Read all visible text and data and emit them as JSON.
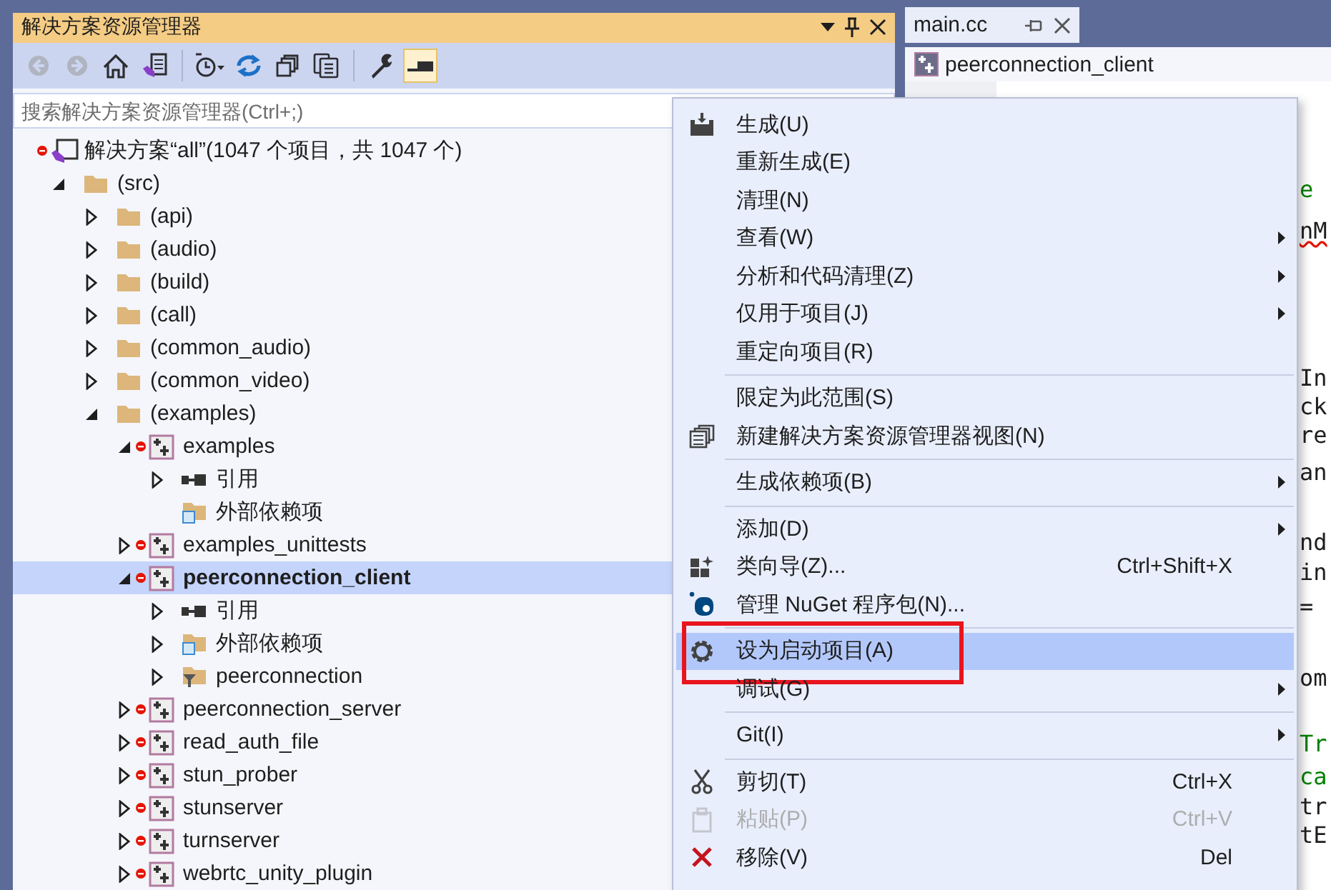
{
  "explorer": {
    "title": "解决方案资源管理器",
    "toolbar": [
      {
        "kind": "back",
        "disabled": true,
        "on": false
      },
      {
        "kind": "forward",
        "disabled": true,
        "on": false
      },
      {
        "kind": "home",
        "disabled": false,
        "on": false
      },
      {
        "kind": "solution-view",
        "disabled": false,
        "on": false
      },
      {
        "kind": "separator"
      },
      {
        "kind": "history",
        "disabled": false,
        "on": false
      },
      {
        "kind": "refresh",
        "disabled": false,
        "on": false
      },
      {
        "kind": "collapse",
        "disabled": false,
        "on": false
      },
      {
        "kind": "copy",
        "disabled": false,
        "on": false
      },
      {
        "kind": "separator"
      },
      {
        "kind": "properties",
        "disabled": false,
        "on": false
      },
      {
        "kind": "preview",
        "disabled": false,
        "on": true
      }
    ],
    "search": {
      "placeholder": "搜索解决方案资源管理器(Ctrl+;)"
    },
    "tree": [
      {
        "label": "解决方案“all”(1047 个项目，共 1047 个)",
        "kind": "solution",
        "error": true,
        "bold": false,
        "selected": false,
        "children": [
          {
            "label": "(src)",
            "kind": "folder",
            "expanded": true,
            "error": false,
            "bold": false,
            "selected": false,
            "children": [
              {
                "label": "(api)",
                "kind": "folder",
                "expanded": false,
                "error": false,
                "bold": false,
                "selected": false
              },
              {
                "label": "(audio)",
                "kind": "folder",
                "expanded": false,
                "error": false,
                "bold": false,
                "selected": false
              },
              {
                "label": "(build)",
                "kind": "folder",
                "expanded": false,
                "error": false,
                "bold": false,
                "selected": false
              },
              {
                "label": "(call)",
                "kind": "folder",
                "expanded": false,
                "error": false,
                "bold": false,
                "selected": false
              },
              {
                "label": "(common_audio)",
                "kind": "folder",
                "expanded": false,
                "error": false,
                "bold": false,
                "selected": false
              },
              {
                "label": "(common_video)",
                "kind": "folder",
                "expanded": false,
                "error": false,
                "bold": false,
                "selected": false
              },
              {
                "label": "(examples)",
                "kind": "folder",
                "expanded": true,
                "error": false,
                "bold": false,
                "selected": false,
                "children": [
                  {
                    "label": "examples",
                    "kind": "project",
                    "expanded": true,
                    "error": true,
                    "bold": false,
                    "selected": false,
                    "children": [
                      {
                        "label": "引用",
                        "kind": "references",
                        "expanded": false,
                        "error": false,
                        "bold": false,
                        "selected": false
                      },
                      {
                        "label": "外部依赖项",
                        "kind": "external",
                        "error": false,
                        "bold": false,
                        "selected": false
                      }
                    ]
                  },
                  {
                    "label": "examples_unittests",
                    "kind": "project",
                    "expanded": false,
                    "error": true,
                    "bold": false,
                    "selected": false
                  },
                  {
                    "label": "peerconnection_client",
                    "kind": "project",
                    "expanded": true,
                    "error": true,
                    "bold": true,
                    "selected": true,
                    "children": [
                      {
                        "label": "引用",
                        "kind": "references",
                        "expanded": false,
                        "error": false,
                        "bold": false,
                        "selected": false
                      },
                      {
                        "label": "外部依赖项",
                        "kind": "external",
                        "expanded": false,
                        "error": false,
                        "bold": false,
                        "selected": false
                      },
                      {
                        "label": "peerconnection",
                        "kind": "filter",
                        "expanded": false,
                        "error": false,
                        "bold": false,
                        "selected": false
                      }
                    ]
                  },
                  {
                    "label": "peerconnection_server",
                    "kind": "project",
                    "expanded": false,
                    "error": true,
                    "bold": false,
                    "selected": false
                  },
                  {
                    "label": "read_auth_file",
                    "kind": "project",
                    "expanded": false,
                    "error": true,
                    "bold": false,
                    "selected": false
                  },
                  {
                    "label": "stun_prober",
                    "kind": "project",
                    "expanded": false,
                    "error": true,
                    "bold": false,
                    "selected": false
                  },
                  {
                    "label": "stunserver",
                    "kind": "project",
                    "expanded": false,
                    "error": true,
                    "bold": false,
                    "selected": false
                  },
                  {
                    "label": "turnserver",
                    "kind": "project",
                    "expanded": false,
                    "error": true,
                    "bold": false,
                    "selected": false
                  },
                  {
                    "label": "webrtc_unity_plugin",
                    "kind": "project",
                    "expanded": false,
                    "error": true,
                    "bold": false,
                    "selected": false
                  }
                ]
              }
            ]
          }
        ]
      }
    ]
  },
  "editor": {
    "tab": {
      "label": "main.cc"
    },
    "nav": {
      "label": "peerconnection_client"
    },
    "code": [
      {
        "text": "e",
        "kind": "comment",
        "squiggle": false
      },
      {
        "text": "nM",
        "kind": "code",
        "squiggle": true
      },
      {
        "text": "In",
        "kind": "code",
        "squiggle": false
      },
      {
        "text": "ck",
        "kind": "code",
        "squiggle": false
      },
      {
        "text": "re",
        "kind": "code",
        "squiggle": false
      },
      {
        "text": "an",
        "kind": "code",
        "squiggle": false
      },
      {
        "text": "nd",
        "kind": "code",
        "squiggle": false
      },
      {
        "text": "in",
        "kind": "code",
        "squiggle": false
      },
      {
        "text": "=",
        "kind": "code",
        "squiggle": false
      },
      {
        "text": "om",
        "kind": "code",
        "squiggle": false
      },
      {
        "text": "Tr",
        "kind": "comment",
        "squiggle": false
      },
      {
        "text": "ca",
        "kind": "comment",
        "squiggle": false
      },
      {
        "text": "tr",
        "kind": "code",
        "squiggle": false
      },
      {
        "text": "tE",
        "kind": "code",
        "squiggle": false
      }
    ]
  },
  "context_menu": {
    "items": [
      {
        "kind": "item",
        "label": "生成(U)",
        "submenu": false,
        "disabled": false,
        "selected": false,
        "marked": false
      },
      {
        "kind": "item",
        "label": "重新生成(E)",
        "submenu": false,
        "disabled": false,
        "selected": false,
        "marked": false
      },
      {
        "kind": "item",
        "label": "清理(N)",
        "submenu": false,
        "disabled": false,
        "selected": false,
        "marked": false
      },
      {
        "kind": "item",
        "label": "查看(W)",
        "submenu": true,
        "disabled": false,
        "selected": false,
        "marked": false
      },
      {
        "kind": "item",
        "label": "分析和代码清理(Z)",
        "submenu": true,
        "disabled": false,
        "selected": false,
        "marked": false
      },
      {
        "kind": "item",
        "label": "仅用于项目(J)",
        "submenu": true,
        "disabled": false,
        "selected": false,
        "marked": false
      },
      {
        "kind": "item",
        "label": "重定向项目(R)",
        "submenu": false,
        "disabled": false,
        "selected": false,
        "marked": false
      },
      {
        "kind": "separator"
      },
      {
        "kind": "item",
        "label": "限定为此范围(S)",
        "submenu": false,
        "disabled": false,
        "selected": false,
        "marked": false
      },
      {
        "kind": "item",
        "label": "新建解决方案资源管理器视图(N)",
        "submenu": false,
        "disabled": false,
        "selected": false,
        "marked": false
      },
      {
        "kind": "separator"
      },
      {
        "kind": "item",
        "label": "生成依赖项(B)",
        "submenu": true,
        "disabled": false,
        "selected": false,
        "marked": false
      },
      {
        "kind": "separator"
      },
      {
        "kind": "item",
        "label": "添加(D)",
        "submenu": true,
        "disabled": false,
        "selected": false,
        "marked": false
      },
      {
        "kind": "item",
        "label": "类向导(Z)...",
        "shortcut": "Ctrl+Shift+X",
        "submenu": false,
        "disabled": false,
        "selected": false,
        "marked": false
      },
      {
        "kind": "item",
        "label": "管理 NuGet 程序包(N)...",
        "submenu": false,
        "disabled": false,
        "selected": false,
        "marked": false
      },
      {
        "kind": "separator"
      },
      {
        "kind": "item",
        "label": "设为启动项目(A)",
        "submenu": false,
        "disabled": false,
        "selected": true,
        "marked": true
      },
      {
        "kind": "item",
        "label": "调试(G)",
        "submenu": true,
        "disabled": false,
        "selected": false,
        "marked": false
      },
      {
        "kind": "separator"
      },
      {
        "kind": "item",
        "label": "Git(I)",
        "submenu": true,
        "disabled": false,
        "selected": false,
        "marked": false
      },
      {
        "kind": "separator"
      },
      {
        "kind": "item",
        "label": "剪切(T)",
        "shortcut": "Ctrl+X",
        "submenu": false,
        "disabled": false,
        "selected": false,
        "marked": false
      },
      {
        "kind": "item",
        "label": "粘贴(P)",
        "shortcut": "Ctrl+V",
        "submenu": false,
        "disabled": true,
        "selected": false,
        "marked": false
      },
      {
        "kind": "item",
        "label": "移除(V)",
        "shortcut": "Del",
        "submenu": false,
        "disabled": false,
        "selected": false,
        "marked": false
      }
    ]
  }
}
